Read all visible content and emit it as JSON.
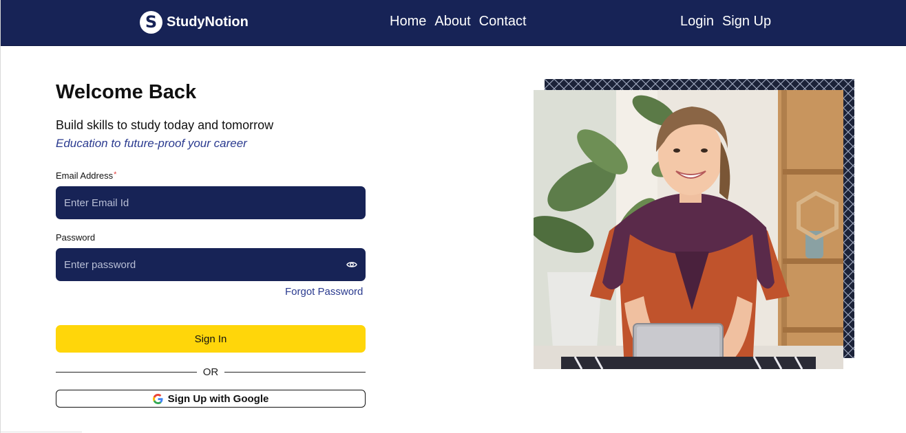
{
  "navbar": {
    "logo_letter": "S",
    "logo_text": "StudyNotion",
    "links": [
      "Home",
      "About",
      "Contact"
    ],
    "auth": [
      "Login",
      "Sign Up"
    ],
    "bg_color": "#172356"
  },
  "form": {
    "heading": "Welcome Back",
    "subtitle": "Build skills to study today and tomorrow",
    "tagline": "Education to future-proof your career",
    "email_label": "Email Address",
    "email_required_mark": "*",
    "email_placeholder": "Enter Email Id",
    "password_label": "Password",
    "password_placeholder": "Enter password",
    "forgot_label": "Forgot Password",
    "signin_label": "Sign In",
    "or_label": "OR",
    "google_label": "Sign Up with Google",
    "accent_color": "#ffd60a"
  },
  "icons": {
    "eye": "eye-icon",
    "google": "google-icon"
  }
}
